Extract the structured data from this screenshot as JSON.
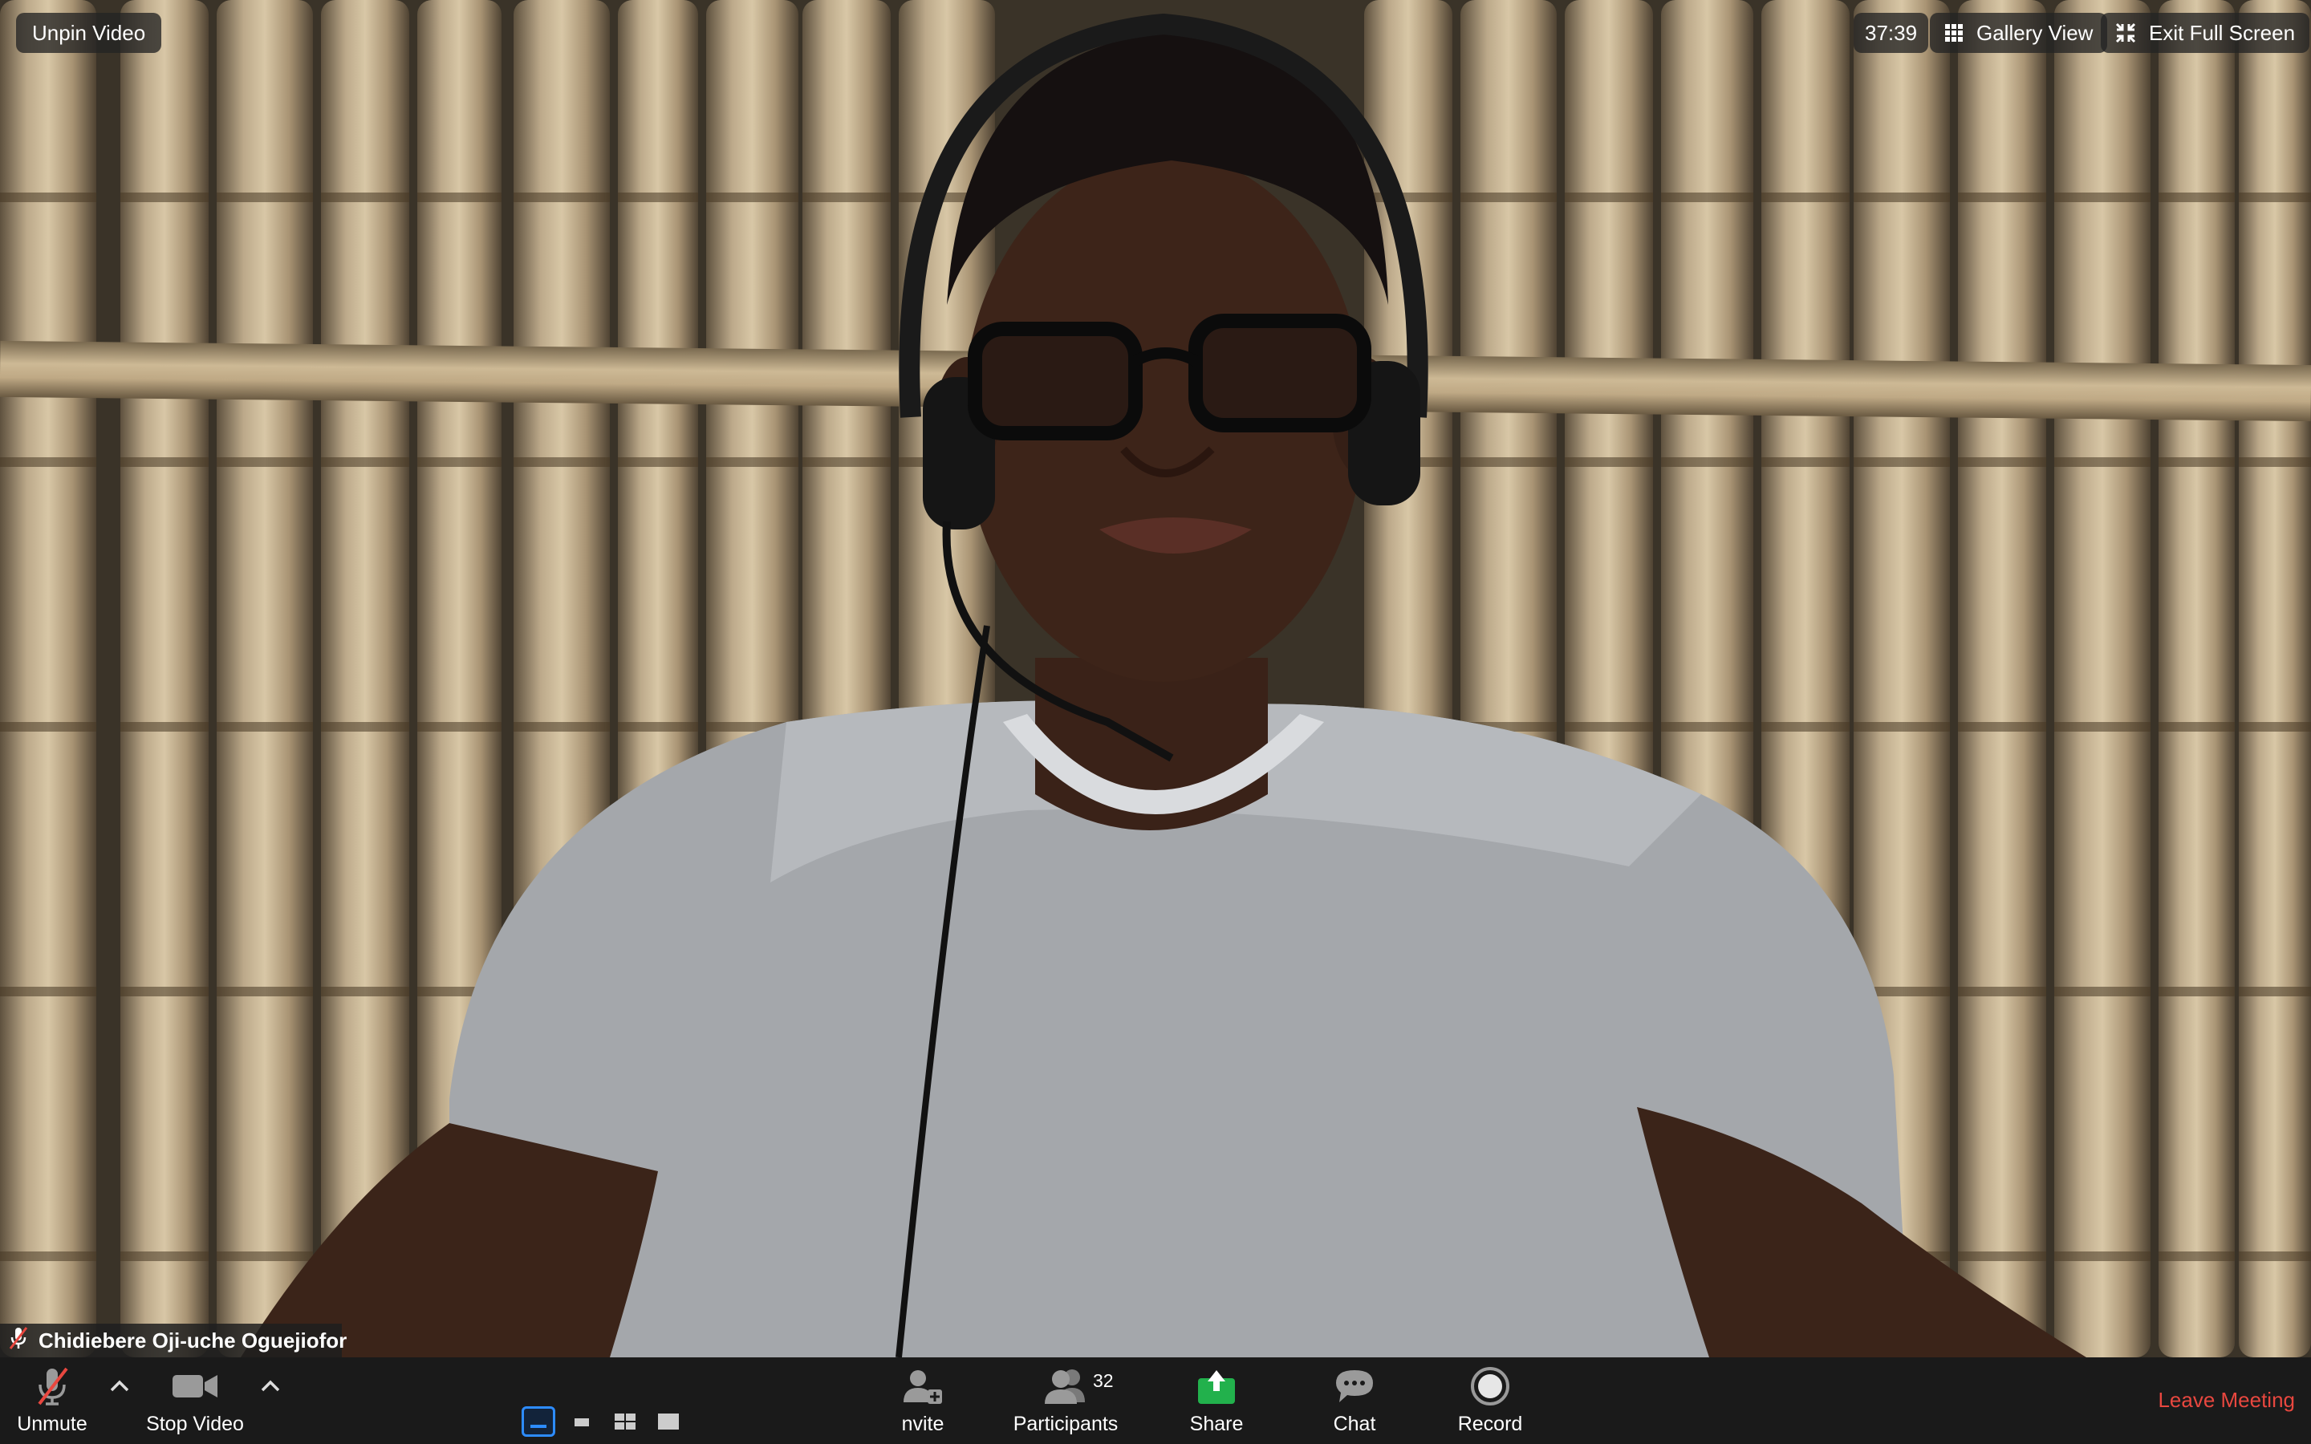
{
  "top_left": {
    "unpin_label": "Unpin Video"
  },
  "top_right": {
    "timer": "37:39",
    "gallery_label": "Gallery View",
    "exit_fullscreen_label": "Exit Full Screen"
  },
  "video": {
    "participant_name": "Chidiebere Oji-uche Oguejiofor"
  },
  "toolbar": {
    "unmute_label": "Unmute",
    "stop_video_label": "Stop Video",
    "invite_label": "nvite",
    "participants_label": "Participants",
    "participants_count": "32",
    "share_label": "Share",
    "chat_label": "Chat",
    "record_label": "Record",
    "leave_label": "Leave Meeting"
  },
  "colors": {
    "leave": "#e8473f",
    "share": "#22b14c",
    "active_layout": "#2d8cff"
  },
  "icons": [
    "microphone-muted-icon",
    "camera-icon",
    "invite-user-icon",
    "participants-icon",
    "share-icon",
    "chat-icon",
    "record-icon",
    "grid-icon",
    "exit-fullscreen-icon"
  ]
}
